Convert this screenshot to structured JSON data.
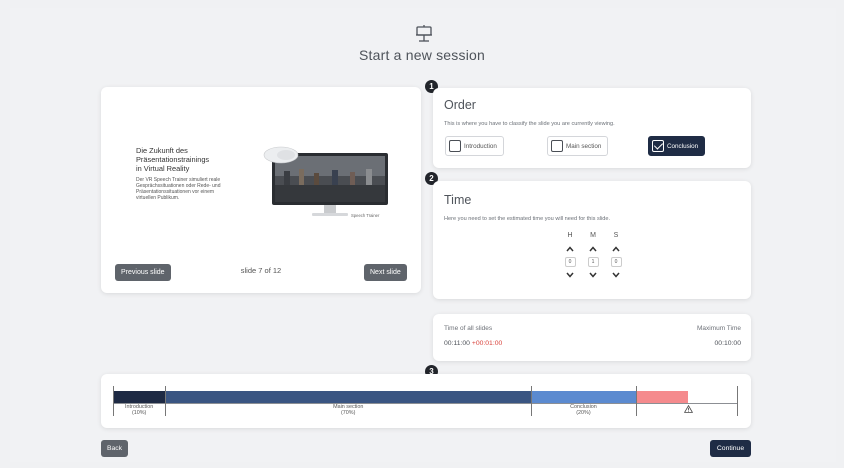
{
  "page": {
    "title": "Start a new session",
    "header_icon": "projector-icon"
  },
  "steps": [
    "1",
    "2",
    "3"
  ],
  "slide_preview": {
    "title_lines": [
      "Die Zukunft des",
      "Präsentationstrainings",
      "in Virtual Reality"
    ],
    "description_lines": [
      "Der VR Speech Trainer simuliert reale",
      "Gesprächssituationen oder Rede- und",
      "Präsentationssituationen vor einem",
      "virtuellen Publikum."
    ],
    "logo_text": "Speech Trainer",
    "prev_label": "Previous slide",
    "next_label": "Next slide",
    "counter": "slide 7 of 12"
  },
  "order": {
    "heading": "Order",
    "description": "This is where you have to classify the slide you are currently viewing.",
    "options": [
      {
        "label": "Introduction",
        "selected": false
      },
      {
        "label": "Main section",
        "selected": false
      },
      {
        "label": "Conclusion",
        "selected": true
      }
    ]
  },
  "time": {
    "heading": "Time",
    "description": "Here you need to set the estimated time you will need for this slide.",
    "labels": [
      "H",
      "M",
      "S"
    ],
    "values": [
      "0",
      "1",
      "0"
    ]
  },
  "summary": {
    "time_all_label": "Time of all slides",
    "time_all_value": "00:11:00",
    "overtime_value": "+00:01:00",
    "max_label": "Maximum Time",
    "max_value": "00:10:00"
  },
  "timeline": {
    "segments": [
      {
        "label": "Introduction",
        "percent_label": "(10%)",
        "fraction": 0.1,
        "color": "#1e2a44"
      },
      {
        "label": "Main section",
        "percent_label": "(70%)",
        "fraction": 0.7,
        "color": "#3a5582"
      },
      {
        "label": "Conclusion",
        "percent_label": "(20%)",
        "fraction": 0.2,
        "color": "#5b8ad0"
      }
    ],
    "overtime_fraction": 0.1,
    "overtime_color": "#f58a8d",
    "warning_icon": "warning-icon"
  },
  "footer": {
    "back_label": "Back",
    "continue_label": "Continue"
  },
  "colors": {
    "primary_dark": "#1f2c45",
    "button_gray": "#5f646b",
    "danger": "#d9423b"
  }
}
